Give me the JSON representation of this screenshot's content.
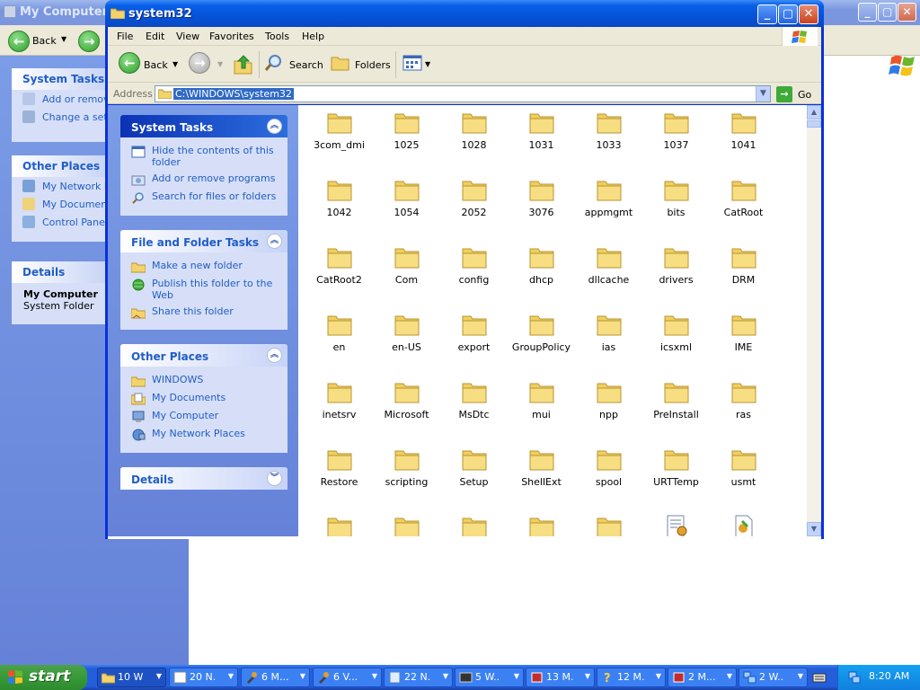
{
  "background_window": {
    "title": "My Computer",
    "back_label": "Back",
    "panels": [
      {
        "title": "System Tasks",
        "items": [
          "Add or remove",
          "Change a sett"
        ]
      },
      {
        "title": "Other Places",
        "items": [
          "My Network Pl",
          "My Documents",
          "Control Panel"
        ]
      },
      {
        "title": "Details",
        "lines": [
          "My Computer",
          "System Folder"
        ]
      }
    ]
  },
  "window": {
    "title": "system32",
    "menu": [
      "File",
      "Edit",
      "View",
      "Favorites",
      "Tools",
      "Help"
    ],
    "toolbar": {
      "back": "Back",
      "search": "Search",
      "folders": "Folders"
    },
    "address": {
      "label": "Address",
      "value": "C:\\WINDOWS\\system32",
      "go": "Go"
    },
    "task_panels": {
      "system_tasks": {
        "title": "System Tasks",
        "items": [
          "Hide the contents of this folder",
          "Add or remove programs",
          "Search for files or folders"
        ]
      },
      "file_folder_tasks": {
        "title": "File and Folder Tasks",
        "items": [
          "Make a new folder",
          "Publish this folder to the Web",
          "Share this folder"
        ]
      },
      "other_places": {
        "title": "Other Places",
        "items": [
          "WINDOWS",
          "My Documents",
          "My Computer",
          "My Network Places"
        ]
      },
      "details": {
        "title": "Details"
      }
    },
    "files": [
      "3com_dmi",
      "1025",
      "1028",
      "1031",
      "1033",
      "1037",
      "1041",
      "1042",
      "1054",
      "2052",
      "3076",
      "appmgmt",
      "bits",
      "CatRoot",
      "CatRoot2",
      "Com",
      "config",
      "dhcp",
      "dllcache",
      "drivers",
      "DRM",
      "en",
      "en-US",
      "export",
      "GroupPolicy",
      "ias",
      "icsxml",
      "IME",
      "inetsrv",
      "Microsoft",
      "MsDtc",
      "mui",
      "npp",
      "PreInstall",
      "ras",
      "Restore",
      "scripting",
      "Setup",
      "ShellExt",
      "spool",
      "URTTemp",
      "usmt"
    ]
  },
  "taskbar": {
    "start": "start",
    "buttons": [
      {
        "label": "10 W",
        "icon": "folder-icon",
        "active": true
      },
      {
        "label": "20 N.",
        "icon": "window-icon"
      },
      {
        "label": "6 M...",
        "icon": "tools-icon"
      },
      {
        "label": "6 V...",
        "icon": "tools-icon"
      },
      {
        "label": "22 N.",
        "icon": "notepad-icon"
      },
      {
        "label": "5 W..",
        "icon": "console-icon"
      },
      {
        "label": "13 M.",
        "icon": "app-icon"
      },
      {
        "label": "12 M.",
        "icon": "help-icon"
      },
      {
        "label": "2 M...",
        "icon": "app-icon"
      },
      {
        "label": "2 W..",
        "icon": "network-icon"
      }
    ],
    "clock": "8:20 AM"
  }
}
